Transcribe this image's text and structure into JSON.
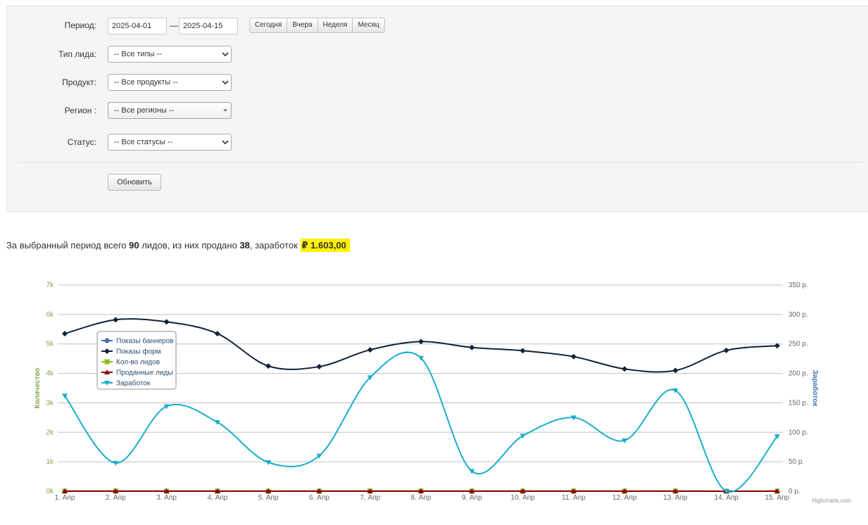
{
  "filters": {
    "period_label": "Период:",
    "date_from": "2025-04-01",
    "date_separator": "—",
    "date_to": "2025-04-15",
    "quick_ranges": [
      "Сегодня",
      "Вчера",
      "Неделя",
      "Месяц"
    ],
    "lead_type_label": "Тип лида:",
    "lead_type_value": "-- Все типы --",
    "product_label": "Продукт:",
    "product_value": "-- Все продукты --",
    "region_label": "Регион :",
    "region_value": "-- Все регионы --",
    "status_label": "Статус:",
    "status_value": "-- Все статусы --",
    "update_button": "Обновить"
  },
  "summary": {
    "prefix": "За выбранный период всего ",
    "total_leads": "90",
    "mid1": " лидов, из них продано ",
    "sold": "38",
    "mid2": ", заработок ",
    "earnings": "₽ 1.603,00"
  },
  "colors": {
    "show_banners": "#4572a7",
    "show_forms": "#0d233a",
    "lead_count": "#8bbc21",
    "sold_leads": "#910000",
    "earnings": "#1aadce",
    "left_axis": "#89a54e",
    "right_axis": "#4572a7"
  },
  "chart_data": {
    "type": "line",
    "categories": [
      "1. Апр",
      "2. Апр",
      "3. Апр",
      "4. Апр",
      "5. Апр",
      "6. Апр",
      "7. Апр",
      "8. Апр",
      "9. Апр",
      "10. Апр",
      "11. Апр",
      "12. Апр",
      "13. Апр",
      "14. Апр",
      "15. Апр"
    ],
    "y_left": {
      "label": "Количество",
      "ticks": [
        "0k",
        "1k",
        "2k",
        "3k",
        "4k",
        "5k",
        "6k",
        "7k"
      ],
      "range": [
        0,
        7000
      ]
    },
    "y_right": {
      "label": "Заработок",
      "ticks": [
        "0 р.",
        "50 р.",
        "100 р.",
        "150 р.",
        "200 р.",
        "250 р.",
        "300 р.",
        "350 р."
      ],
      "range": [
        0,
        350
      ]
    },
    "series": [
      {
        "name": "Показы баннеров",
        "axis": "left",
        "marker": "circle",
        "values": [
          0,
          0,
          0,
          0,
          0,
          0,
          0,
          0,
          0,
          0,
          0,
          0,
          0,
          0,
          0
        ]
      },
      {
        "name": "Показы форм",
        "axis": "left",
        "marker": "diamond",
        "values": [
          5350,
          5820,
          5750,
          5350,
          4250,
          4230,
          4800,
          5080,
          4880,
          4770,
          4570,
          4150,
          4100,
          4780,
          4940
        ]
      },
      {
        "name": "Кол-во лидов",
        "axis": "left",
        "marker": "square",
        "values": [
          5,
          7,
          6,
          5,
          4,
          6,
          8,
          9,
          5,
          6,
          7,
          4,
          6,
          3,
          5
        ]
      },
      {
        "name": "Проданные лиды",
        "axis": "left",
        "marker": "triangle",
        "values": [
          2,
          3,
          3,
          2,
          2,
          3,
          4,
          4,
          2,
          3,
          3,
          2,
          3,
          1,
          2
        ]
      },
      {
        "name": "Заработок",
        "axis": "right",
        "marker": "triangle-down",
        "values": [
          162,
          48,
          144,
          117,
          49,
          60,
          193,
          226,
          34,
          94,
          125,
          86,
          171,
          0,
          93
        ]
      }
    ],
    "grid": true,
    "legend_position": "top-left",
    "credits": "Highcharts.com"
  }
}
